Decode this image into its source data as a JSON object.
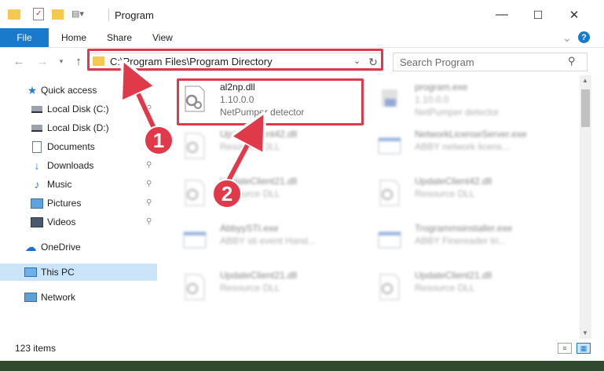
{
  "window": {
    "title": "Program",
    "minimize_label": "—",
    "maximize_label": "☐",
    "close_label": "✕"
  },
  "ribbon": {
    "tabs": [
      "File",
      "Home",
      "Share",
      "View"
    ],
    "expand_label": "⌄",
    "help_label": "?"
  },
  "navigation": {
    "address": "C:\\Program Files\\Program Directory",
    "search_placeholder": "Search Program"
  },
  "sidebar": {
    "items": [
      {
        "label": "Quick access",
        "icon": "star-icon",
        "pinned": false
      },
      {
        "label": "Local Disk (C:)",
        "icon": "drive-icon",
        "pinned": true
      },
      {
        "label": "Local Disk (D:)",
        "icon": "drive-icon",
        "pinned": false
      },
      {
        "label": "Documents",
        "icon": "document-icon",
        "pinned": true
      },
      {
        "label": "Downloads",
        "icon": "download-icon",
        "pinned": true
      },
      {
        "label": "Music",
        "icon": "music-icon",
        "pinned": true
      },
      {
        "label": "Pictures",
        "icon": "pictures-icon",
        "pinned": true
      },
      {
        "label": "Videos",
        "icon": "videos-icon",
        "pinned": true
      },
      {
        "label": "OneDrive",
        "icon": "cloud-icon",
        "pinned": false
      },
      {
        "label": "This PC",
        "icon": "computer-icon",
        "pinned": false,
        "selected": true
      },
      {
        "label": "Network",
        "icon": "network-icon",
        "pinned": false
      }
    ]
  },
  "files": [
    {
      "name": "al2np.dll",
      "line2": "1.10.0.0",
      "line3": "NetPumper detector",
      "icon": "dll-gear-icon",
      "highlighted": true
    },
    {
      "name": "program.exe",
      "line2": "1.10.0.0",
      "line3": "NetPumper detector",
      "icon": "installer-icon"
    },
    {
      "name": "UpdateClient42.dll",
      "line2": "Resource DLL",
      "line3": "",
      "icon": "dll-gear-icon"
    },
    {
      "name": "NetworkLicenseServer.exe",
      "line2": "ABBY network licens...",
      "line3": "",
      "icon": "window-app-icon"
    },
    {
      "name": "UpdateClient21.dll",
      "line2": "Resource DLL",
      "line3": "",
      "icon": "dll-gear-icon"
    },
    {
      "name": "UpdateClient42.dll",
      "line2": "Resource DLL",
      "line3": "",
      "icon": "dll-gear-icon"
    },
    {
      "name": "AbbyySTI.exe",
      "line2": "ABBY sti event Hand...",
      "line3": "",
      "icon": "window-app-icon"
    },
    {
      "name": "Trogrammsinstaller.exe",
      "line2": "ABBY Finereader tri...",
      "line3": "",
      "icon": "window-app-icon"
    },
    {
      "name": "UpdateClient21.dll",
      "line2": "Resource DLL",
      "line3": "",
      "icon": "dll-gear-icon"
    },
    {
      "name": "UpdateClient21.dll",
      "line2": "Resource DLL",
      "line3": "",
      "icon": "dll-gear-icon"
    }
  ],
  "status": {
    "item_count": "123 items"
  },
  "annotations": {
    "step1": "1",
    "step2": "2",
    "color": "#e0394a"
  },
  "colors": {
    "accent": "#1979ca",
    "highlight": "#e0394a"
  }
}
